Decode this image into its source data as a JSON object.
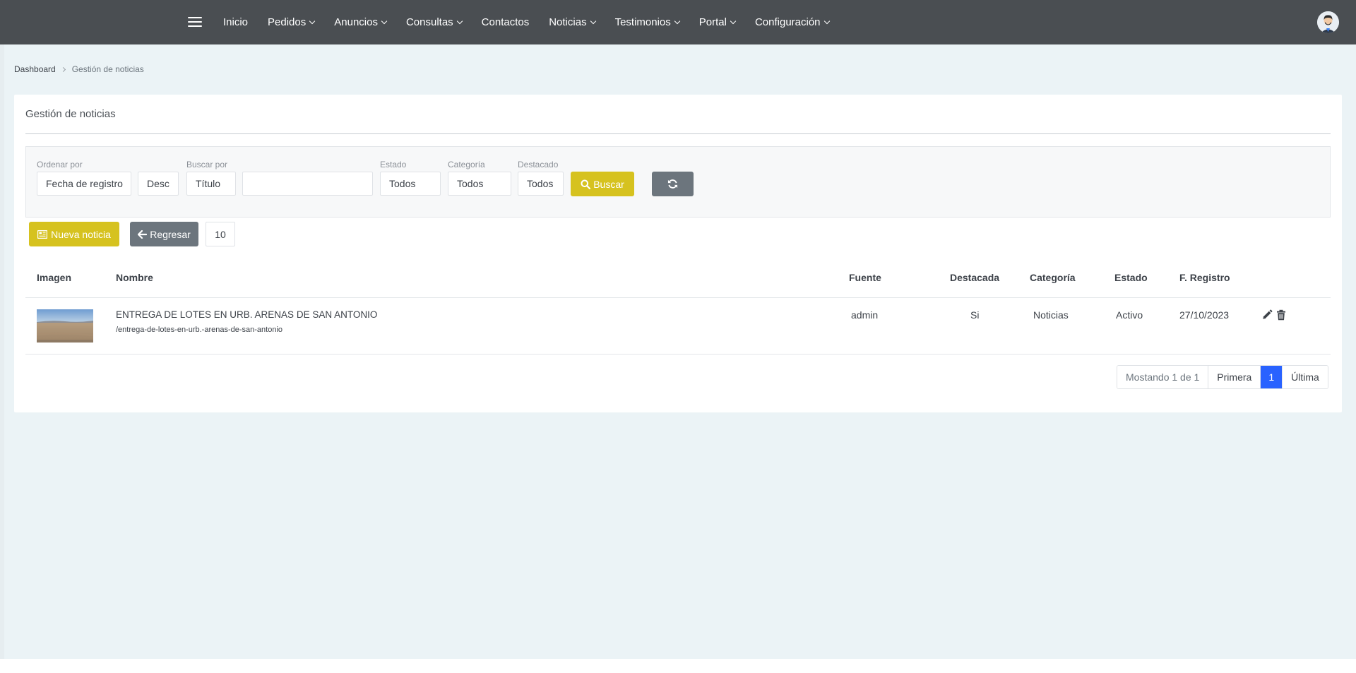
{
  "nav": {
    "items": [
      {
        "label": "Inicio",
        "dropdown": false
      },
      {
        "label": "Pedidos",
        "dropdown": true
      },
      {
        "label": "Anuncios",
        "dropdown": true
      },
      {
        "label": "Consultas",
        "dropdown": true
      },
      {
        "label": "Contactos",
        "dropdown": false
      },
      {
        "label": "Noticias",
        "dropdown": true
      },
      {
        "label": "Testimonios",
        "dropdown": true
      },
      {
        "label": "Portal",
        "dropdown": true
      },
      {
        "label": "Configuración",
        "dropdown": true
      }
    ]
  },
  "breadcrumb": {
    "root": "Dashboard",
    "current": "Gestión de noticias"
  },
  "card": {
    "title": "Gestión de noticias"
  },
  "filters": {
    "order_by_label": "Ordenar por",
    "order_by_value": "Fecha de registro",
    "order_dir_value": "Desc",
    "search_by_label": "Buscar por",
    "search_by_value": "Título",
    "search_text_value": "",
    "estado_label": "Estado",
    "estado_value": "Todos",
    "categoria_label": "Categoría",
    "categoria_value": "Todos",
    "destacado_label": "Destacado",
    "destacado_value": "Todos",
    "search_button": "Buscar",
    "refresh_icon": "refresh-icon"
  },
  "actions": {
    "new_label": "Nueva noticia",
    "back_label": "Regresar",
    "page_size": "10"
  },
  "table": {
    "headers": [
      "Imagen",
      "Nombre",
      "Fuente",
      "Destacada",
      "Categoría",
      "Estado",
      "F. Registro"
    ],
    "rows": [
      {
        "nombre": "ENTREGA DE LOTES EN URB. ARENAS DE SAN ANTONIO",
        "slug": "/entrega-de-lotes-en-urb.-arenas-de-san-antonio",
        "fuente": "admin",
        "destacada": "Si",
        "categoria": "Noticias",
        "estado": "Activo",
        "fecha": "27/10/2023"
      }
    ]
  },
  "pagination": {
    "info": "Mostando 1 de 1",
    "first": "Primera",
    "current": "1",
    "last": "Última"
  },
  "colors": {
    "topbar": "#4a4e52",
    "accent": "#d6c21f",
    "secondary": "#6c757d",
    "active_page": "#2962ff",
    "page_bg": "#ebf3f6"
  }
}
